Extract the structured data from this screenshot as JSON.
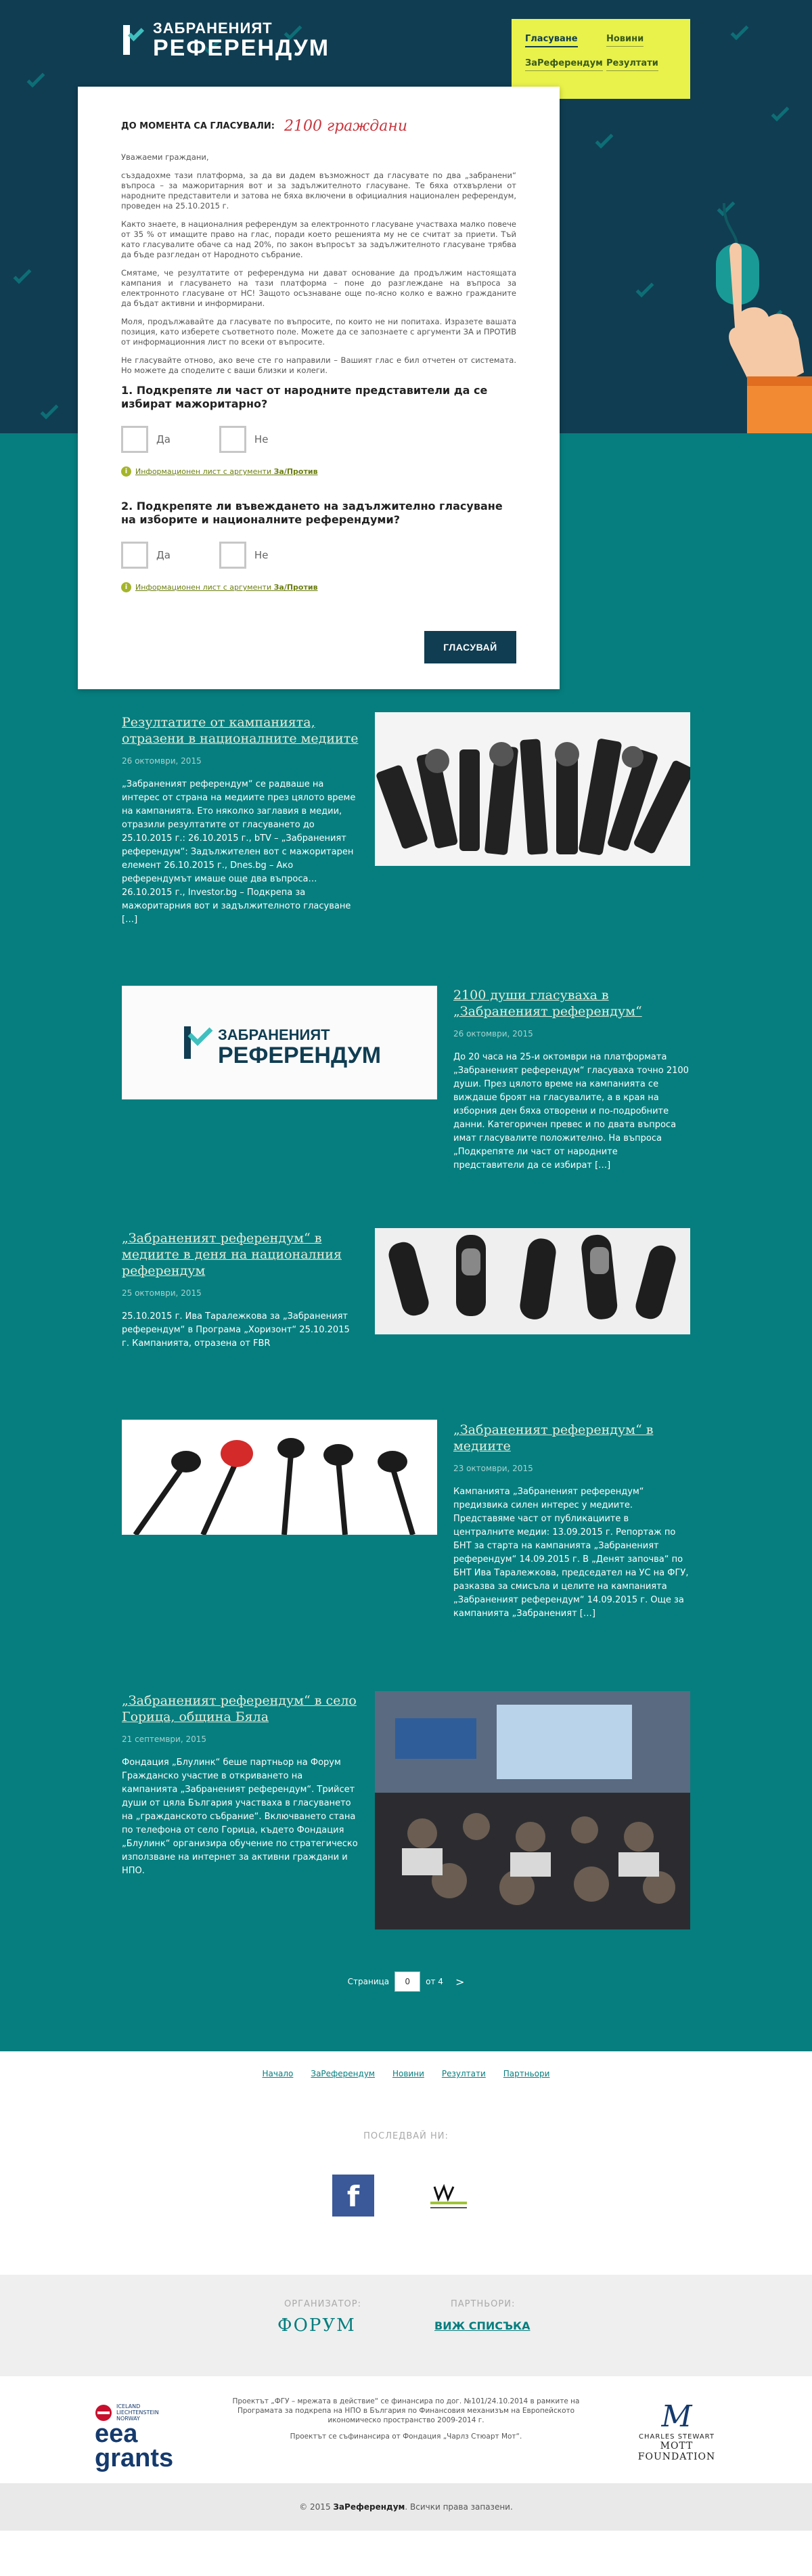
{
  "header": {
    "logo_top": "ЗАБРАНЕНИЯТ",
    "logo_bottom": "РЕФЕРЕНДУМ",
    "nav": [
      {
        "label": "Гласуване",
        "active": true
      },
      {
        "label": "Новини",
        "active": false
      },
      {
        "label": "ЗаРеферендум",
        "active": false
      },
      {
        "label": "Резултати",
        "active": false
      }
    ]
  },
  "vote_card": {
    "counter_label": "ДО МОМЕНТА СА ГЛАСУВАЛИ:",
    "counter_value": "2100 граждани",
    "paragraphs": [
      "Уважаеми граждани,",
      "създадохме тази платформа, за да ви дадем възможност да гласувате по два „забранени“ въпроса – за мажоритарния вот и за задължителното гласуване. Те бяха отхвърлени от народните представители и затова не бяха включени в официалния национален референдум, проведен на 25.10.2015 г.",
      "Както знаете, в националния референдум за електронното гласуване участваха малко повече от 35 % от имащите право на глас, поради което решенията му не се считат за приети. Тъй като гласувалите обаче са над 20%, по закон въпросът за задължителното гласуване трябва да бъде разгледан от Народното събрание.",
      "Смятаме, че резултатите от референдума ни дават основание да продължим настоящата кампания и гласуването на тази платформа – поне до разглеждане на въпроса за електронното гласуване от НС! Защото осъзнаване още по-ясно колко е важно гражданите да бъдат активни и информирани.",
      "Моля, продължавайте да гласувате по въпросите, по които не ни попитаха. Изразете вашата позиция, като изберете съответното поле. Можете да се запознаете с аргументи ЗА и ПРОТИВ от информационния лист по всеки от въпросите.",
      "Не гласувайте отново, ако вече сте го направили – Вашият глас е бил отчетен от системата. Но можете да споделите с ваши близки и колеги."
    ],
    "questions": [
      {
        "text": "1. Подкрепяте ли част от народните представители да се избират мажоритарно?",
        "yes": "Да",
        "no": "Не",
        "info_link": "Информационен лист с аргументи",
        "info_bold": "За/Против"
      },
      {
        "text": "2. Подкрепяте ли въвеждането на задължително гласуване на изборите и националните референдуми?",
        "yes": "Да",
        "no": "Не",
        "info_link": "Информационен лист с аргументи",
        "info_bold": "За/Против"
      }
    ],
    "submit_label": "ГЛАСУВАЙ"
  },
  "posts": [
    {
      "title": "Резултатите от кампанията, отразени в националните медиите",
      "date": "26 октомври, 2015",
      "excerpt": "„Забраненият референдум“ се радваше на интерес от страна на медиите през цялото време на кампанията. Ето няколко заглавия в медии, отразили резултатите от гласуването до 25.10.2015 г.: 26.10.2015 г., bTV – „Забраненият референдум“: Задължителен вот с мажоритарен елемент 26.10.2015 г., Dnes.bg – Ако референдумът имаше още два въпроса… 26.10.2015 г., Investor.bg – Подкрепа за мажоритарния вот и задължителното гласуване […]"
    },
    {
      "title": "2100 души гласуваха в „Забраненият референдум“",
      "date": "26 октомври, 2015",
      "excerpt": "До 20 часа на 25-и октомври на платформата „Забраненият референдум“ гласуваха точно 2100 души. През цялото време на кампанията се виждаше броят на гласувалите, а в края на изборния ден бяха отворени и по-подробните данни. Категоричен превес и по двата въпроса имат гласувалите положително. На въпроса „Подкрепяте ли част от народните представители да се избират […]"
    },
    {
      "title": "„Забраненият референдум“ в медиите в деня на националния референдум",
      "date": "25 октомври, 2015",
      "excerpt": "25.10.2015 г. Ива Таралежкова за „Забраненият референдум“ в Програма „Хоризонт“ 25.10.2015 г. Кампанията, отразена от FBR"
    },
    {
      "title": "„Забраненият референдум“ в медиите",
      "date": "23 октомври, 2015",
      "excerpt": "Кампанията „Забраненият референдум“ предизвика силен интерес у медиите. Представяме част от публикациите в централните медии: 13.09.2015 г. Репортаж по БНТ за старта на кампанията „Забраненият референдум“ 14.09.2015 г. В „Денят започва“ по БНТ Ива Таралежкова, председател на УС на ФГУ, разказва за смисъла и целите на кампанията „Забраненият референдум“ 14.09.2015 г. Още за кампанията „Забраненият […]"
    },
    {
      "title": "„Забраненият референдум“ в село Горица, община Бяла",
      "date": "21 септември, 2015",
      "excerpt": "Фондация „Блулинк“ беше партньор на Форум Гражданско участие в откриването на кампанията „Забраненият референдум“. Трийсет души от цяла България участваха в гласуването на „гражданското събрание“. Включването стана по телефона от село Горица, където Фондация „Блулинк“ организира обучение  по стратегическо използване на интернет за активни граждани и НПО."
    }
  ],
  "pagination": {
    "label": "Страница",
    "current": "0",
    "of_label": "от 4",
    "next": ">"
  },
  "footer": {
    "links": [
      "Начало",
      "ЗаРеферендум",
      "Новини",
      "Резултати",
      "Партньори"
    ],
    "follow_label": "ПОСЛЕДВАЙ НИ:",
    "facebook_glyph": "f",
    "organizer_label": "ОРГАНИЗАТОР:",
    "organizer_name": "ФОРУМ",
    "partners_label": "ПАРТНЬОРИ:",
    "partners_link": "ВИЖ СПИСЪКА",
    "eea_small": "ICELAND LIECHTENSTEIN NORWAY",
    "eea_name": "eea grants",
    "funding_text_1": "Проектът „ФГУ – мрежата в действие“ се финансира по дог. №101/24.10.2014 в рамките на Програмата за подкрепа на НПО в България по Финансовия механизъм на Европейското икономическо пространство 2009-2014 г.",
    "funding_text_2": "Проектът се съфинансира от Фондация „Чарлз Стюарт Мот“.",
    "mott_mark": "M",
    "mott_line1": "CHARLES STEWART",
    "mott_line2": "MOTT FOUNDATION",
    "copyright_pre": "© 2015",
    "copyright_brand": "ЗаРеферендум",
    "copyright_post": ". Всички права запазени."
  },
  "colors": {
    "hero": "#103d52",
    "teal": "#067e7f",
    "accent": "#e9f24a",
    "counter": "#c8363e"
  }
}
